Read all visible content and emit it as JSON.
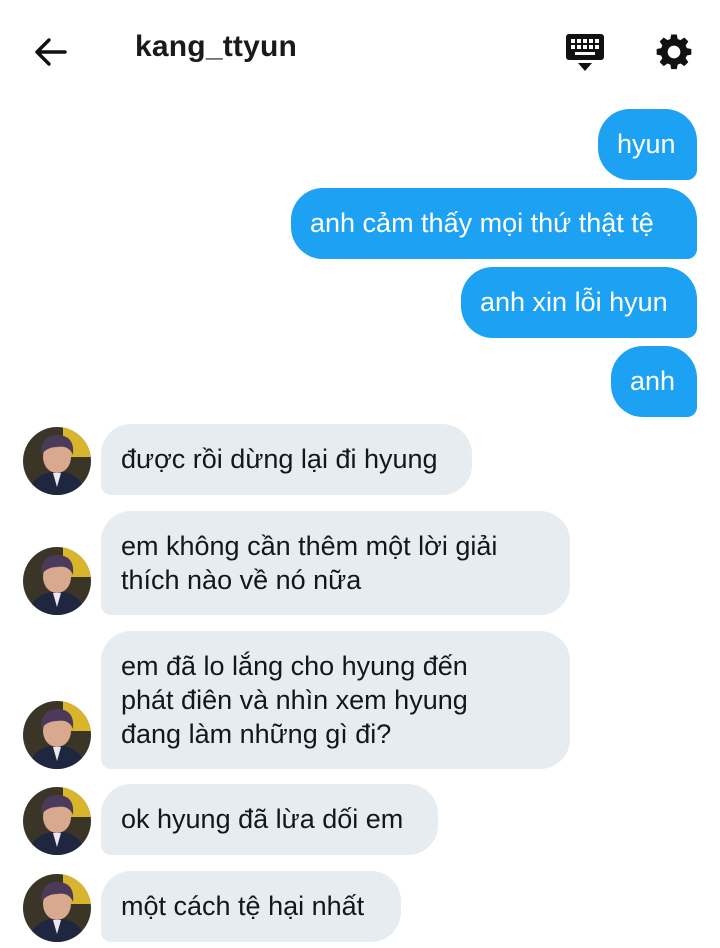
{
  "header": {
    "title": "kang_ttyun",
    "back_icon": "arrow-left-icon",
    "keyboard_icon": "keyboard-icon",
    "settings_icon": "gear-icon"
  },
  "colors": {
    "outgoing_bubble": "#1da1f2",
    "incoming_bubble": "#e6ecf0"
  },
  "messages": {
    "out": [
      "hyun",
      "anh cảm thấy mọi thứ thật tệ",
      "anh xin lỗi hyun",
      "anh"
    ],
    "in": [
      "được rồi dừng lại đi hyung",
      "em không cần thêm một lời giải\nthích nào về nó nữa",
      "em đã lo lắng cho hyung đến\nphát điên và nhìn xem hyung\nđang làm những gì đi?",
      "ok hyung đã lừa dối em",
      "một cách tệ hại nhất"
    ]
  }
}
